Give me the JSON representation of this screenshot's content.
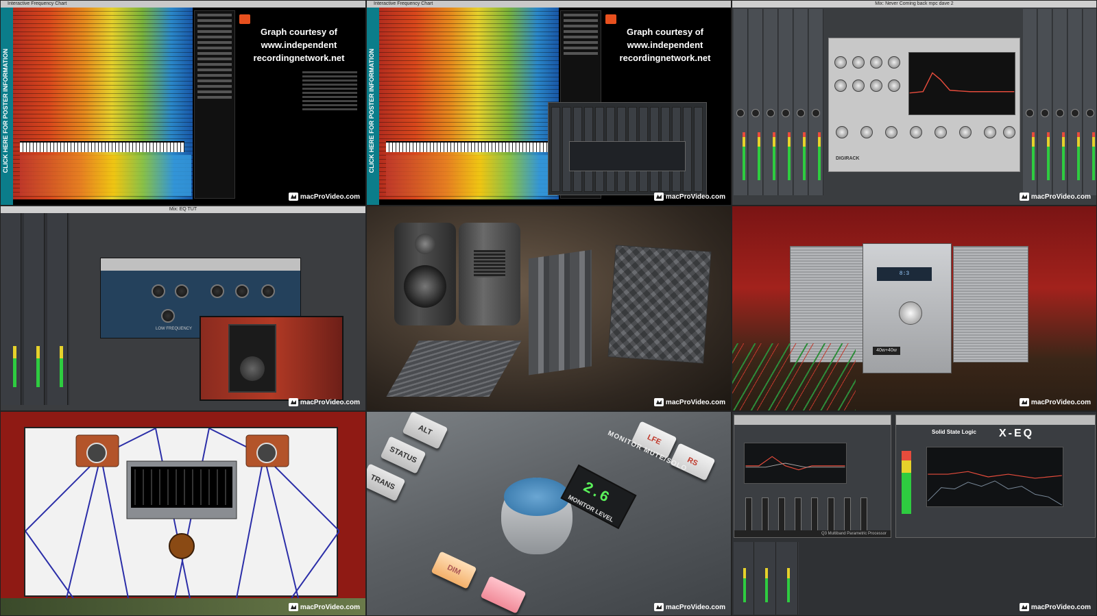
{
  "watermark": {
    "brand": "macProVideo.com"
  },
  "tile1": {
    "window_title": "Interactive Frequency Chart",
    "sidebar_text": "CLICK HERE FOR POSTER INFORMATION",
    "credit_lines": [
      "Graph courtesy of",
      "www.independent",
      "recordingnetwork.net"
    ]
  },
  "tile2": {
    "window_title": "Interactive Frequency Chart",
    "sidebar_text": "CLICK HERE FOR POSTER INFORMATION",
    "credit_lines": [
      "Graph courtesy of",
      "www.independent",
      "recordingnetwork.net"
    ]
  },
  "tile3": {
    "window_title": "Mix: Never Coming back mpc dave 2",
    "plugin_name": "DIGIRACK"
  },
  "tile4": {
    "window_title": "Mix: EQ TUT",
    "plugin_label": "LOW FREQUENCY"
  },
  "tile6": {
    "display": "8:3",
    "badge": "40w+40w"
  },
  "tile8": {
    "buttons": [
      "ALT",
      "STATUS",
      "TRANS",
      "LFE",
      "RS",
      "DIM"
    ],
    "section_label": "MONITOR MUTE/SOLO",
    "lcd_value": "2.6",
    "lcd_label": "MONITOR LEVEL"
  },
  "tile9": {
    "brand_label": "Solid State Logic",
    "plugin_title": "X-EQ",
    "footer_label": "Q3 Multiband Parametric Processor"
  }
}
